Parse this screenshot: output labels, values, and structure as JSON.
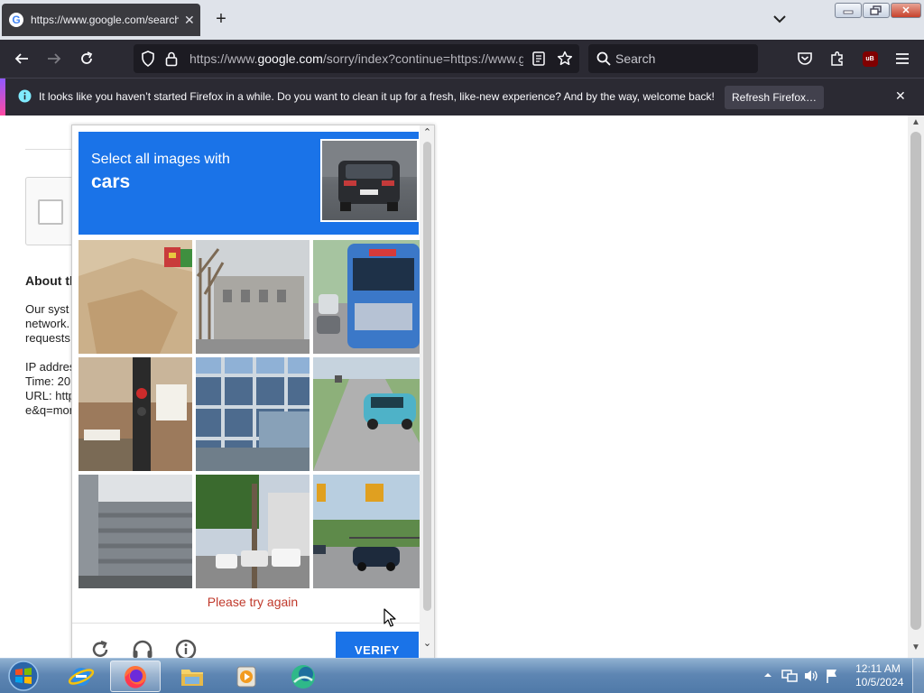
{
  "browser": {
    "tab": {
      "title": "https://www.google.com/search",
      "favicon_letter": "G"
    },
    "address": {
      "prefix": "https://www.",
      "domain": "google.com",
      "suffix": "/sorry/index?continue=https://www.google.com/search"
    },
    "search_placeholder": "Search",
    "addon_badge": "uB"
  },
  "notification": {
    "message": "It looks like you haven’t started Firefox in a while. Do you want to clean it up for a fresh, like-new experience? And by the way, welcome back!",
    "button_label": "Refresh Firefox…",
    "close_symbol": "✕"
  },
  "page": {
    "about_heading": "About th",
    "lines": [
      "Our syst",
      "network.",
      "requests",
      "",
      "IP addres",
      "Time: 20",
      "URL: http",
      "e&q=mor"
    ]
  },
  "captcha": {
    "prompt_line1": "Select all images with",
    "prompt_target": "cars",
    "error_text": "Please try again",
    "verify_label": "VERIFY",
    "tile_subjects": [
      "sand-construction",
      "building-trees",
      "blue-bus",
      "give-way-sign",
      "glass-building",
      "teal-car-road",
      "highrise-building",
      "street-parked-cars",
      "intersection-car"
    ]
  },
  "taskbar": {
    "apps": [
      "internet-explorer",
      "firefox",
      "file-explorer",
      "media-player",
      "app-green"
    ],
    "clock_time": "12:11 AM",
    "clock_date": "10/5/2024"
  },
  "colors": {
    "accent": "#1a73e8",
    "error": "#c0392b",
    "toolbar_dark": "#2b2a33"
  }
}
